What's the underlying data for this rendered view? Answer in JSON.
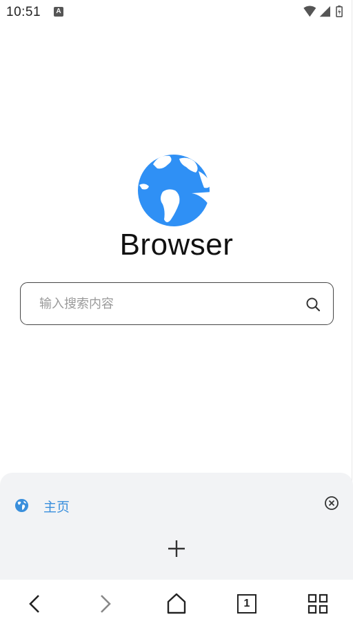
{
  "status_bar": {
    "time": "10:51",
    "icons": [
      "a-notification-icon",
      "wifi-icon",
      "signal-icon",
      "battery-charging-icon"
    ]
  },
  "logo": {
    "brand_name": "Browser",
    "icon": "globe-logo-icon",
    "color": "#2f90f5"
  },
  "search": {
    "placeholder": "输入搜索内容",
    "value": "",
    "icon": "search-icon"
  },
  "tabs_panel": {
    "tabs": [
      {
        "label": "主页",
        "icon": "globe-icon",
        "close_icon": "close-circle-icon"
      }
    ],
    "add_icon": "plus-icon",
    "accent": "#3a8fdc"
  },
  "bottom_nav": {
    "items": [
      "back-icon",
      "forward-icon",
      "home-icon",
      "tabs-icon",
      "menu-grid-icon"
    ],
    "tab_count": "1"
  }
}
